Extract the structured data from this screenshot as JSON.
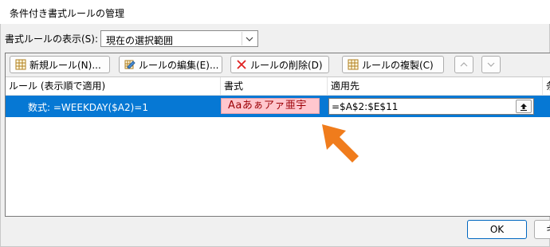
{
  "window": {
    "title": "条件付き書式ルールの管理"
  },
  "show_rules": {
    "label": "書式ルールの表示(S):",
    "value": "現在の選択範囲"
  },
  "toolbar": {
    "new_rule": "新規ルール(N)...",
    "edit_rule": "ルールの編集(E)...",
    "delete_rule": "ルールの削除(D)",
    "duplicate_rule": "ルールの複製(C)"
  },
  "table": {
    "headers": [
      "ルール (表示順で適用)",
      "書式",
      "適用先",
      "条"
    ],
    "rows": [
      {
        "rule": "数式: =WEEKDAY($A2)=1",
        "format_preview": "Aaあぁアァ亜宇",
        "applies_to": "=$A$2:$E$11",
        "selected": true
      }
    ]
  },
  "footer": {
    "ok": "OK",
    "cancel": "キ"
  },
  "colors": {
    "selection": "#0678d4",
    "preview_fill": "#ffc7ce",
    "preview_text": "#9c0006",
    "annotation_arrow": "#f07c1c"
  }
}
